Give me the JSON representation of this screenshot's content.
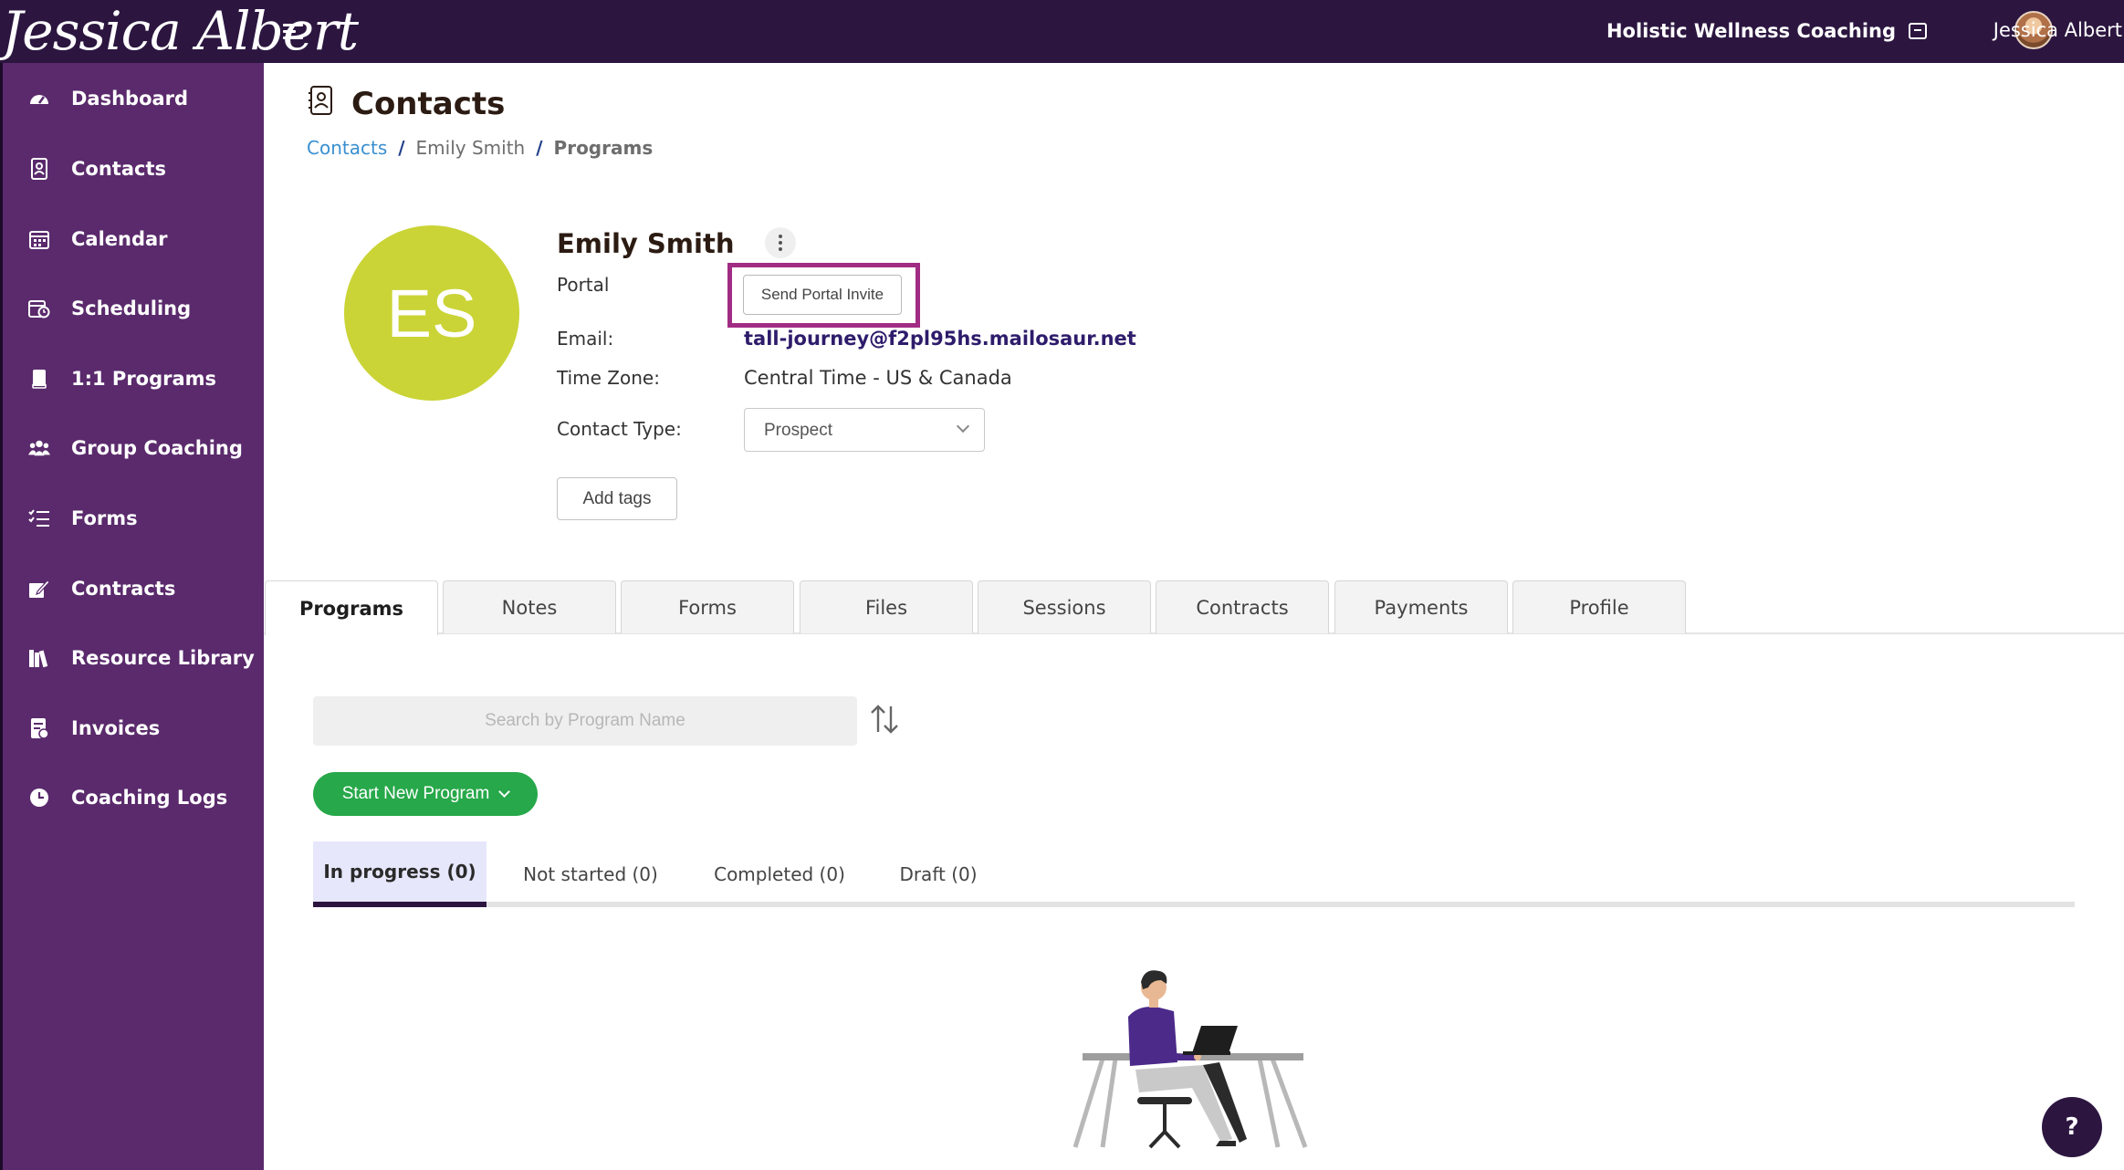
{
  "topbar": {
    "logo_text": "Jessica Albert",
    "business_name": "Holistic Wellness Coaching",
    "user_name": "Jessica Albert"
  },
  "sidebar": {
    "items": [
      {
        "label": "Dashboard",
        "icon": "dashboard-icon"
      },
      {
        "label": "Contacts",
        "icon": "contacts-icon"
      },
      {
        "label": "Calendar",
        "icon": "calendar-icon"
      },
      {
        "label": "Scheduling",
        "icon": "scheduling-icon"
      },
      {
        "label": "1:1 Programs",
        "icon": "book-icon"
      },
      {
        "label": "Group Coaching",
        "icon": "group-icon"
      },
      {
        "label": "Forms",
        "icon": "forms-icon"
      },
      {
        "label": "Contracts",
        "icon": "contract-icon"
      },
      {
        "label": "Resource Library",
        "icon": "library-icon"
      },
      {
        "label": "Invoices",
        "icon": "invoice-icon"
      },
      {
        "label": "Coaching Logs",
        "icon": "clock-icon"
      }
    ]
  },
  "page": {
    "title": "Contacts",
    "breadcrumb": {
      "root": "Contacts",
      "contact": "Emily Smith",
      "current": "Programs"
    }
  },
  "contact": {
    "initials": "ES",
    "name": "Emily Smith",
    "portal_label": "Portal",
    "portal_button": "Send Portal Invite",
    "email_label": "Email:",
    "email": "tall-journey@f2pl95hs.mailosaur.net",
    "timezone_label": "Time Zone:",
    "timezone": "Central Time - US & Canada",
    "type_label": "Contact Type:",
    "type_value": "Prospect",
    "add_tags": "Add tags",
    "avatar_color": "#cad436"
  },
  "tabs": [
    "Programs",
    "Notes",
    "Forms",
    "Files",
    "Sessions",
    "Contracts",
    "Payments",
    "Profile"
  ],
  "active_tab": "Programs",
  "programs": {
    "search_placeholder": "Search by Program Name",
    "start_button": "Start New Program",
    "subtabs": [
      "In progress (0)",
      "Not started (0)",
      "Completed (0)",
      "Draft (0)"
    ],
    "active_subtab": "In progress (0)"
  },
  "help_label": "?",
  "colors": {
    "topbar": "#2c1640",
    "sidebar": "#5a2a6c",
    "accent_green": "#27a84a",
    "highlight": "#a12c84",
    "link": "#3a8fd0"
  }
}
